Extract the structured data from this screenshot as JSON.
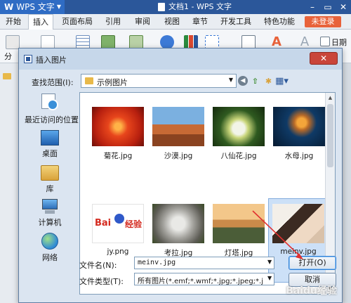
{
  "app": {
    "logo_text": "WPS 文字",
    "doc_title": "文档1 - WPS 文字",
    "menu": [
      "开始",
      "插入",
      "页面布局",
      "引用",
      "审阅",
      "视图",
      "章节",
      "开发工具",
      "特色功能"
    ],
    "active_menu_index": 1,
    "login_label": "未登录",
    "ribbon_left_label": "分",
    "ribbon_right_label": "日期"
  },
  "dialog": {
    "title": "插入图片",
    "close_symbol": "✕",
    "look_in_label": "查找范围(I):",
    "look_in_value": "示例图片",
    "places": [
      {
        "label": "最近访问的位置",
        "icon": "recent-places-icon"
      },
      {
        "label": "桌面",
        "icon": "desktop-icon"
      },
      {
        "label": "库",
        "icon": "libraries-icon"
      },
      {
        "label": "计算机",
        "icon": "computer-icon"
      },
      {
        "label": "网络",
        "icon": "network-icon"
      }
    ],
    "files": [
      {
        "name": "菊花.jpg",
        "icon": "chrysanthemum-thumbnail"
      },
      {
        "name": "沙漠.jpg",
        "icon": "desert-thumbnail"
      },
      {
        "name": "八仙花.jpg",
        "icon": "hydrangeas-thumbnail"
      },
      {
        "name": "水母.jpg",
        "icon": "jellyfish-thumbnail"
      },
      {
        "name": "jy.png",
        "icon": "baidu-jingyan-logo-thumbnail",
        "logo_text": "Bai",
        "logo_text2": "经验"
      },
      {
        "name": "考拉.jpg",
        "icon": "koala-thumbnail"
      },
      {
        "name": "灯塔.jpg",
        "icon": "lighthouse-thumbnail"
      },
      {
        "name": "meinv.jpg",
        "icon": "portrait-thumbnail",
        "selected": true
      }
    ],
    "file_name_label": "文件名(N):",
    "file_name_value": "meinv.jpg",
    "file_type_label": "文件类型(T):",
    "file_type_value": "所有图片(*.emf;*.wmf;*.jpg;*.jpeg;*.j",
    "open_button": "打开(O)",
    "cancel_button": "取消"
  },
  "watermark": "Baidu经验",
  "colors": {
    "wps_title": "#2b579a",
    "dialog_bg": "#dbe5f1",
    "selection": "#cce0f7",
    "annotation": "#e03030",
    "login": "#e8623a"
  }
}
